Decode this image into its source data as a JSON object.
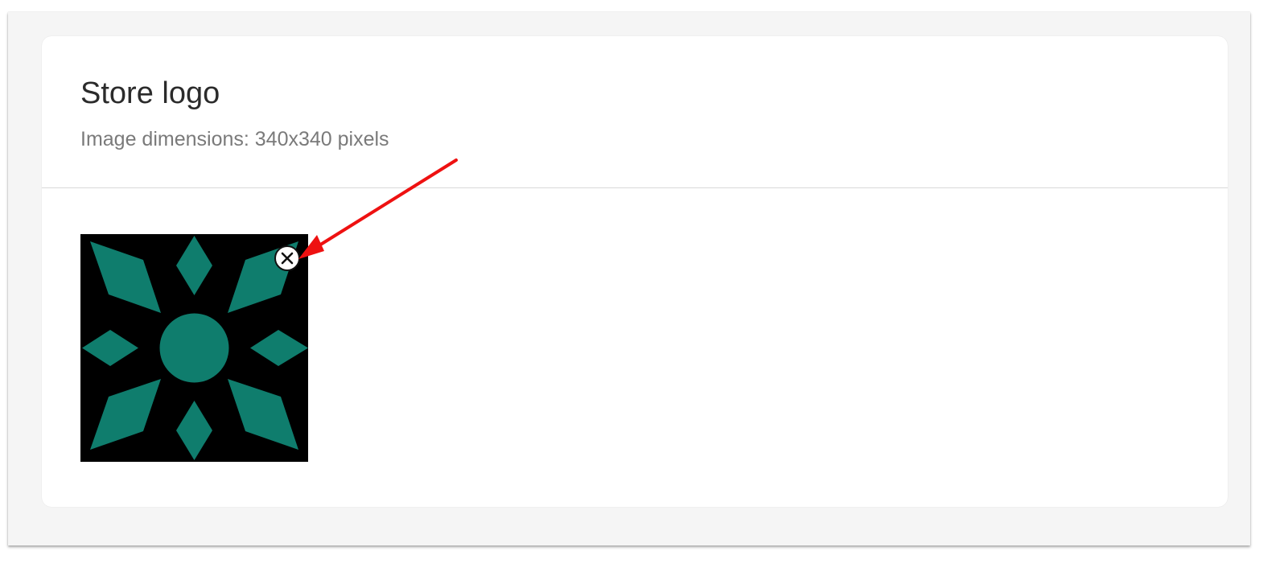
{
  "section": {
    "title": "Store logo",
    "subtitle": "Image dimensions: 340x340 pixels"
  },
  "logo": {
    "alt": "Store logo image",
    "background_color": "#000000",
    "shape_color": "#0f7d6d"
  },
  "remove_button": {
    "icon": "close-icon",
    "label": "Remove image"
  },
  "annotation": {
    "color": "#ee1111"
  }
}
